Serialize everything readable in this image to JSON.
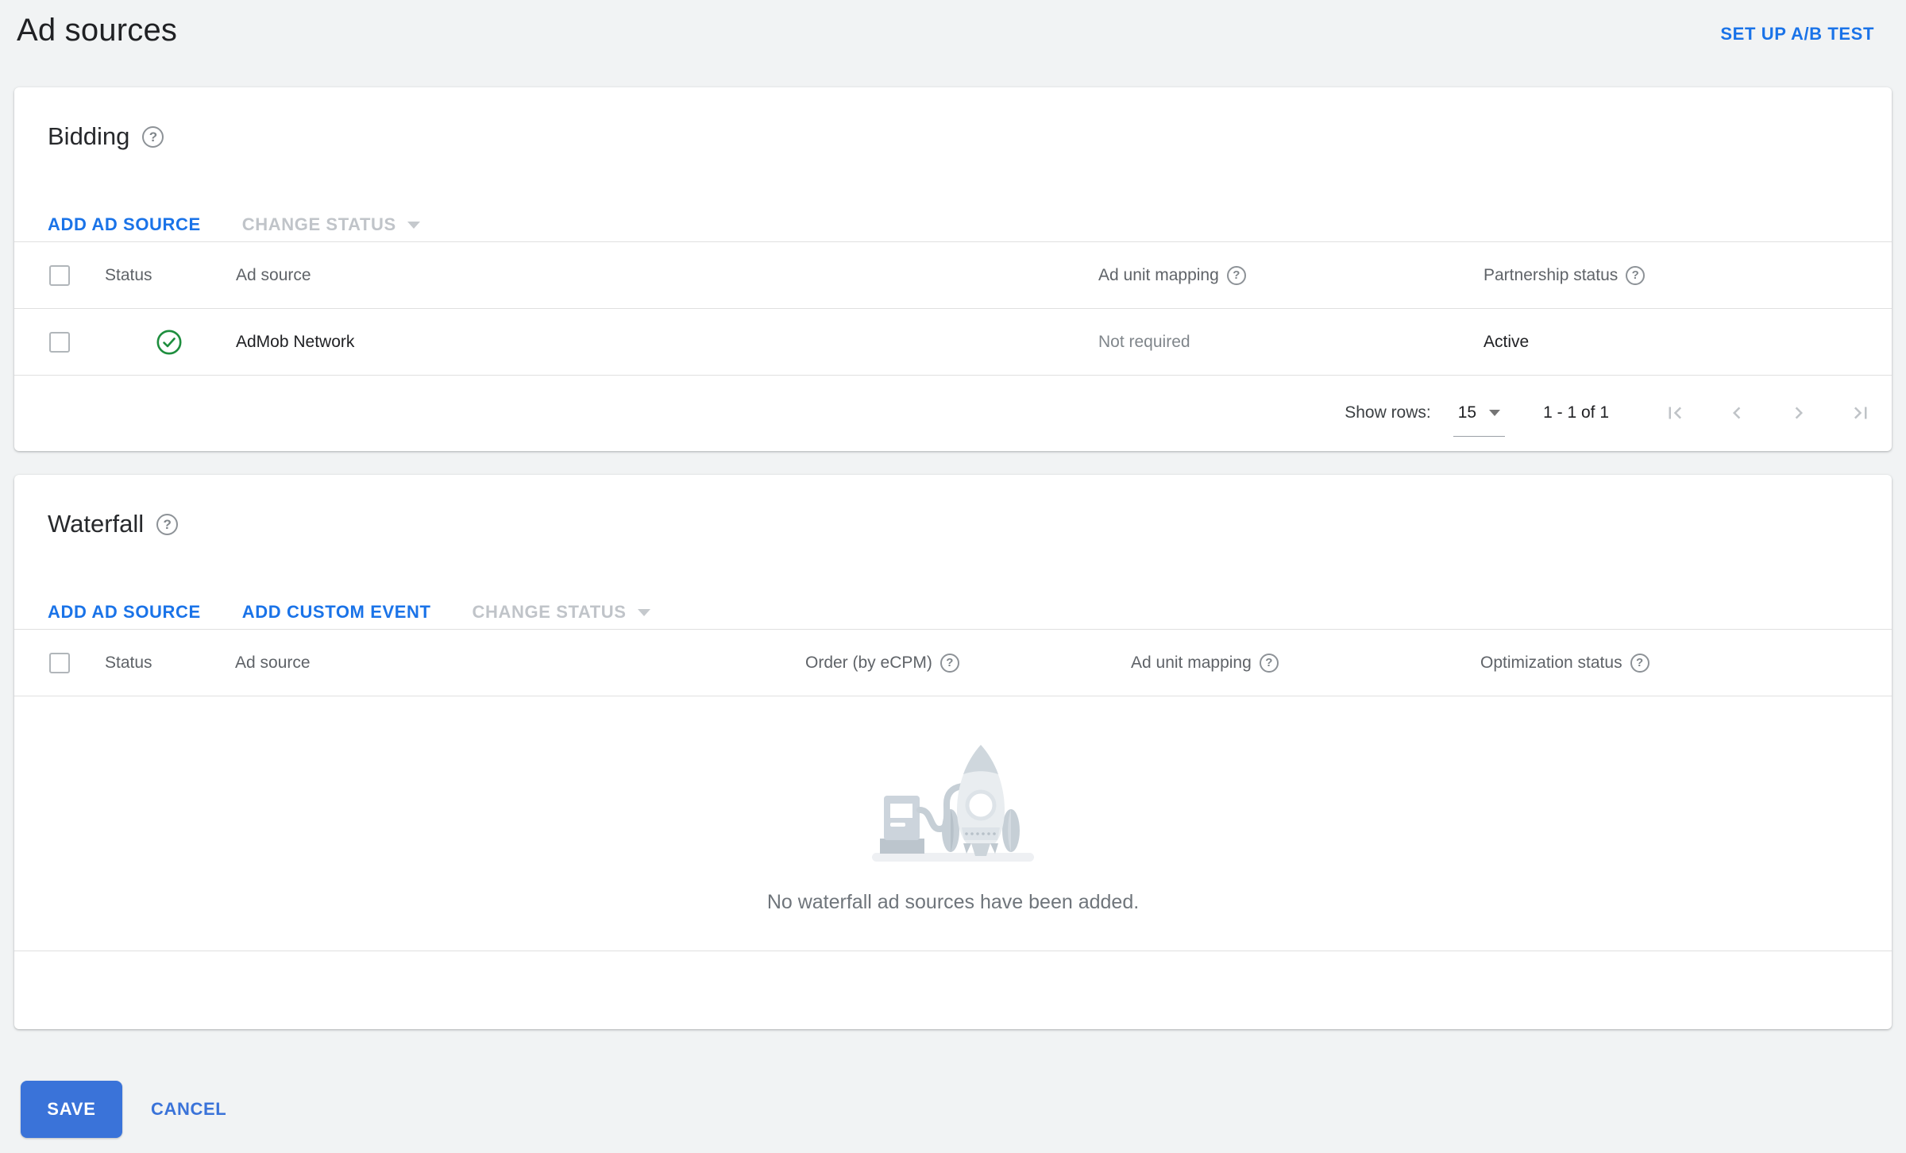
{
  "page": {
    "title": "Ad sources",
    "ab_test_label": "SET UP A/B TEST"
  },
  "icons": {
    "help": "?"
  },
  "bidding": {
    "title": "Bidding",
    "actions": {
      "add_ad_source": "ADD AD SOURCE",
      "change_status": "CHANGE STATUS"
    },
    "table": {
      "columns": [
        "Status",
        "Ad source",
        "Ad unit mapping",
        "Partnership status"
      ],
      "rows": [
        {
          "name": "AdMob Network",
          "status": "active",
          "ad_unit_mapping": "Not required",
          "partnership_status": "Active"
        }
      ]
    },
    "pagination": {
      "show_rows_label": "Show rows:",
      "rows_value": "15",
      "range": "1 - 1 of 1"
    }
  },
  "waterfall": {
    "title": "Waterfall",
    "actions": {
      "add_ad_source": "ADD AD SOURCE",
      "add_custom_event": "ADD CUSTOM EVENT",
      "change_status": "CHANGE STATUS"
    },
    "table": {
      "columns": [
        "Status",
        "Ad source",
        "Order (by eCPM)",
        "Ad unit mapping",
        "Optimization status"
      ]
    },
    "empty_message": "No waterfall ad sources have been added."
  },
  "footer": {
    "save": "SAVE",
    "cancel": "CANCEL"
  },
  "colors": {
    "link_blue": "#1a73e8",
    "save_blue": "#3a73d9",
    "status_green": "#1e8e3e",
    "page_bg": "#f1f3f4"
  }
}
